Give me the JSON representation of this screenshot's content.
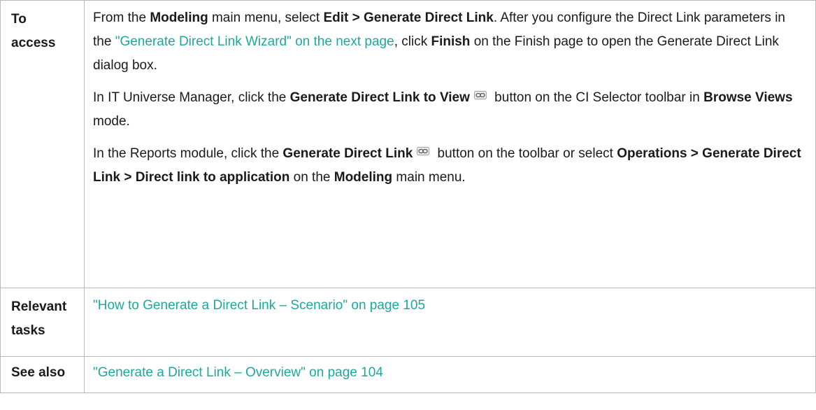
{
  "rows": {
    "access": {
      "label_line1": "To",
      "label_line2": "access",
      "p1": {
        "t1": "From the ",
        "b1": "Modeling",
        "t2": " main menu, select ",
        "b2": "Edit > Generate Direct Link",
        "t3": ". After you configure the Direct Link parameters in the ",
        "link": "\"Generate Direct Link Wizard\" on the next page",
        "t4": ", click ",
        "b3": "Finish",
        "t5": " on the Finish page to open the Generate Direct Link dialog box."
      },
      "p2": {
        "t1": "In IT Universe Manager, click the ",
        "b1": "Generate Direct Link to View",
        "icon": "chain-link-icon",
        "t2": " button on the CI Selector toolbar in ",
        "b2": "Browse Views",
        "t3": " mode."
      },
      "p3": {
        "t1": "In the Reports module, click the ",
        "b1": "Generate Direct Link",
        "icon": "chain-link-icon",
        "t2": " button on the toolbar or select ",
        "b2": "Operations > Generate Direct Link > Direct link to application",
        "t3": " on the ",
        "b3": "Modeling",
        "t4": " main menu."
      }
    },
    "tasks": {
      "label_line1": "Relevant",
      "label_line2": "tasks",
      "link": "\"How to Generate a Direct Link – Scenario\" on page 105"
    },
    "see_also": {
      "label": "See also",
      "link": "\"Generate a Direct Link – Overview\" on page 104"
    }
  },
  "colors": {
    "link": "#1fa89a",
    "border": "#b9b9b9",
    "text": "#1a1a1a"
  }
}
